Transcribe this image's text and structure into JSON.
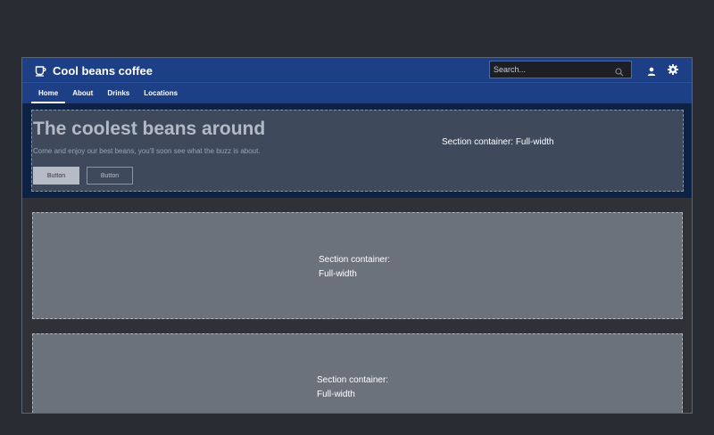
{
  "app": {
    "brand_name": "Cool beans coffee",
    "brand_icon": "coffee-cup-icon"
  },
  "header": {
    "search_placeholder": "Search...",
    "search_icon": "search-icon",
    "user_icon": "user-icon",
    "settings_icon": "gear-icon"
  },
  "nav": {
    "tabs": [
      {
        "label": "Home",
        "active": true
      },
      {
        "label": "About",
        "active": false
      },
      {
        "label": "Drinks",
        "active": false
      },
      {
        "label": "Locations",
        "active": false
      }
    ]
  },
  "hero": {
    "title": "The coolest beans around",
    "subtitle": "Come and enjoy our best beans, you'll soon see what the buzz is about.",
    "primary_button": "Button",
    "secondary_button": "Button",
    "container_label": "Section container:  Full-width"
  },
  "sections": [
    {
      "line1": "Section container:",
      "line2": "Full-width"
    },
    {
      "line1": "Section container:",
      "line2": "Full-width"
    }
  ],
  "colors": {
    "header_bg": "#1c3f86",
    "hero_band_bg": "#0e2246",
    "page_bg": "#2a2c33",
    "section_bg": "#6b727c"
  }
}
